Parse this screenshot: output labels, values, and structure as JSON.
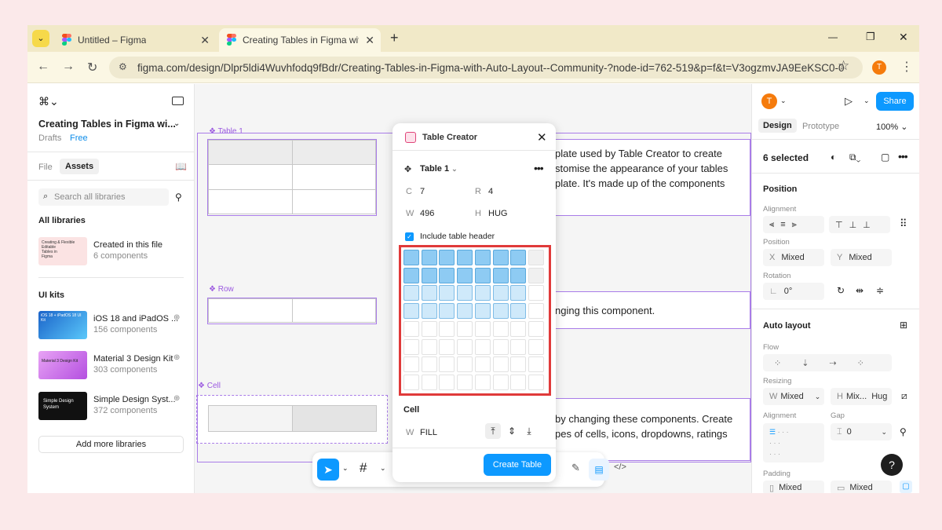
{
  "browser": {
    "tabs": [
      {
        "title": "Untitled – Figma",
        "close": "✕"
      },
      {
        "title": "Creating Tables in Figma with A",
        "close": "✕"
      }
    ],
    "new_tab": "+",
    "window_controls": {
      "minimize": "—",
      "maximize": "❐",
      "close": "✕"
    },
    "url": "figma.com/design/Dlpr5ldi4Wuvhfodq9fBdr/Creating-Tables-in-Figma-with-Auto-Layout--Community-?node-id=762-519&p=f&t=V3ogzmvJA9EeKSC0-0",
    "profile_initial": "T"
  },
  "left_panel": {
    "file_title": "Creating Tables in Figma wi...",
    "location": "Drafts",
    "plan_badge": "Free",
    "tabs": [
      "File",
      "Assets"
    ],
    "search_placeholder": "Search all libraries",
    "all_libraries_heading": "All libraries",
    "local_library": {
      "name": "Created in this file",
      "count": "6 components",
      "thumb_lines": [
        "Creating",
        "& Flexible",
        "Editable",
        "Tables",
        "in",
        "Figma"
      ]
    },
    "ui_kits_heading": "UI kits",
    "kits": [
      {
        "name": "iOS 18 and iPadOS ...",
        "count": "156 components",
        "thumb_text": "iOS 18 + iPadOS 18 UI Kit"
      },
      {
        "name": "Material 3 Design Kit",
        "count": "303 components",
        "thumb_text": "Material 3 Design Kit"
      },
      {
        "name": "Simple Design Syst...",
        "count": "372 components",
        "thumb_text": "Simple Design System"
      }
    ],
    "add_button": "Add more libraries"
  },
  "canvas": {
    "labels": {
      "table": "Table 1",
      "row": "Row",
      "cell": "Cell"
    },
    "text_blocks": [
      "plate used by Table Creator to create\nstomise the appearance of your tables\nplate. It's made up of the components",
      "nging this component.",
      "by changing these components. Create\npes of cells, icons, dropdowns, ratings"
    ]
  },
  "dialog": {
    "title": "Table Creator",
    "table_name": "Table 1",
    "c_label": "C",
    "c_value": "7",
    "r_label": "R",
    "r_value": "4",
    "w_label": "W",
    "w_value": "496",
    "h_label": "H",
    "h_value": "HUG",
    "header_checkbox": "Include table header",
    "grid": {
      "columns": 8,
      "rows": 8,
      "selected_columns": 7,
      "header_rows": 2,
      "body_rows": 2
    },
    "cell_heading": "Cell",
    "cell_w_label": "W",
    "cell_w_value": "FILL",
    "create_button": "Create Table"
  },
  "right_panel": {
    "avatar_initial": "T",
    "share_button": "Share",
    "tabs": [
      "Design",
      "Prototype"
    ],
    "zoom": "100%",
    "selection": "6 selected",
    "position_heading": "Position",
    "alignment_label": "Alignment",
    "position_label": "Position",
    "x_label": "X",
    "x_value": "Mixed",
    "y_label": "Y",
    "y_value": "Mixed",
    "rotation_label": "Rotation",
    "rotation_value": "0°",
    "auto_layout_heading": "Auto layout",
    "flow_label": "Flow",
    "resizing_label": "Resizing",
    "w_label": "W",
    "w_value": "Mixed",
    "h_label": "H",
    "h_value": "Mix...",
    "h_hug": "Hug",
    "alignment2_label": "Alignment",
    "gap_label": "Gap",
    "gap_value": "0",
    "padding_label": "Padding",
    "padding_h": "Mixed",
    "padding_v": "Mixed",
    "help": "?"
  }
}
